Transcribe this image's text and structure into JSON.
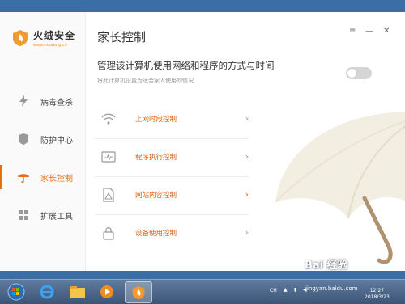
{
  "app": {
    "name": "火绒安全",
    "url": "www.huorong.cn"
  },
  "sidebar": {
    "items": [
      {
        "label": "病毒查杀",
        "icon": "lightning-icon"
      },
      {
        "label": "防护中心",
        "icon": "shield-icon"
      },
      {
        "label": "家长控制",
        "icon": "umbrella-icon"
      },
      {
        "label": "扩展工具",
        "icon": "grid-icon"
      }
    ]
  },
  "main": {
    "title": "家长控制",
    "heading": "管理该计算机使用网络和程序的方式与时间",
    "subtitle": "将此计算机设置为适合家人使用的情况",
    "toggle": false,
    "items": [
      {
        "label": "上网时段控制",
        "icon": "wifi-icon"
      },
      {
        "label": "程序执行控制",
        "icon": "program-window-icon"
      },
      {
        "label": "网站内容控制",
        "icon": "document-warning-icon"
      },
      {
        "label": "设备使用控制",
        "icon": "lock-icon"
      }
    ]
  },
  "window_controls": {
    "menu": "≡",
    "minimize": "—",
    "close": "✕"
  },
  "taskbar": {
    "lang": "CH",
    "watermark": "Bai 经验",
    "watermark_url": "jingyan.baidu.com",
    "time": "12:27",
    "date": "2018/3/23"
  },
  "colors": {
    "accent": "#ee6a14",
    "taskbar": "#4a6587"
  }
}
